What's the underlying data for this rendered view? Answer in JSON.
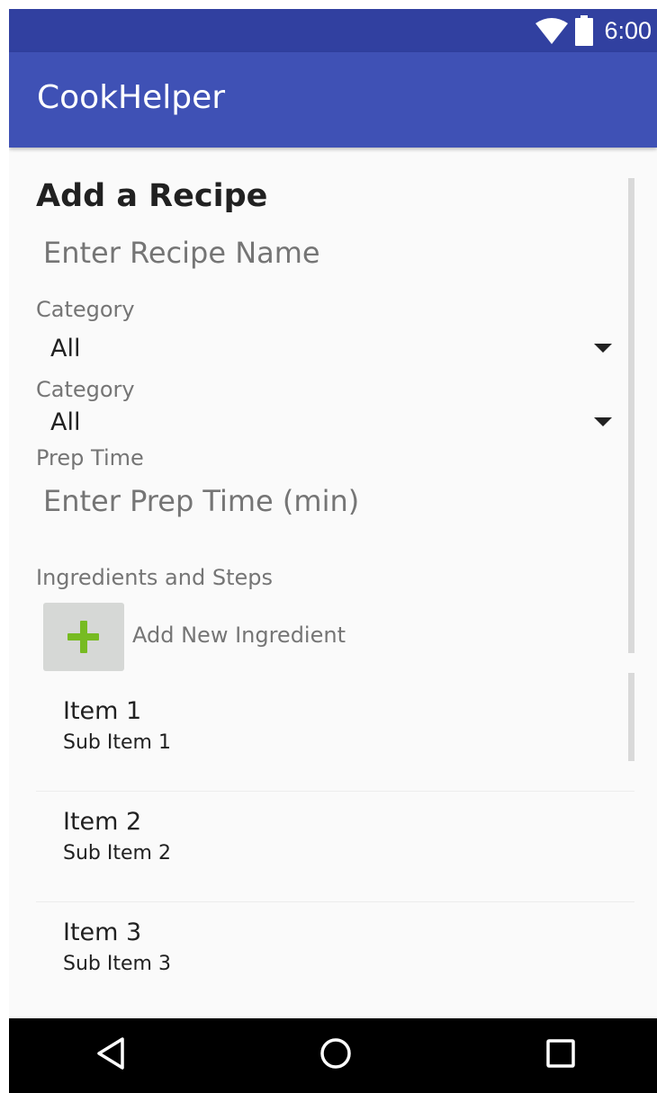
{
  "status_bar": {
    "time": "6:00",
    "icons": [
      "wifi-icon",
      "battery-icon"
    ]
  },
  "app_bar": {
    "title": "CookHelper"
  },
  "form": {
    "heading": "Add a Recipe",
    "recipe_name_placeholder": "Enter Recipe Name",
    "category_1": {
      "label": "Category",
      "value": "All"
    },
    "category_2": {
      "label": "Category",
      "value": "All"
    },
    "prep_time": {
      "label": "Prep Time",
      "placeholder": "Enter Prep Time (min)"
    },
    "ingredients": {
      "label": "Ingredients and Steps",
      "add_label": "Add New Ingredient"
    }
  },
  "list": {
    "items": [
      {
        "title": "Item 1",
        "subtitle": "Sub Item 1"
      },
      {
        "title": "Item 2",
        "subtitle": "Sub Item 2"
      },
      {
        "title": "Item 3",
        "subtitle": "Sub Item 3"
      }
    ]
  },
  "nav": {
    "icons": [
      "back-icon",
      "home-icon",
      "recents-icon"
    ]
  },
  "colors": {
    "primary": "#3f51b5",
    "primary_dark": "#3140a0",
    "add_icon": "#77bb22"
  }
}
